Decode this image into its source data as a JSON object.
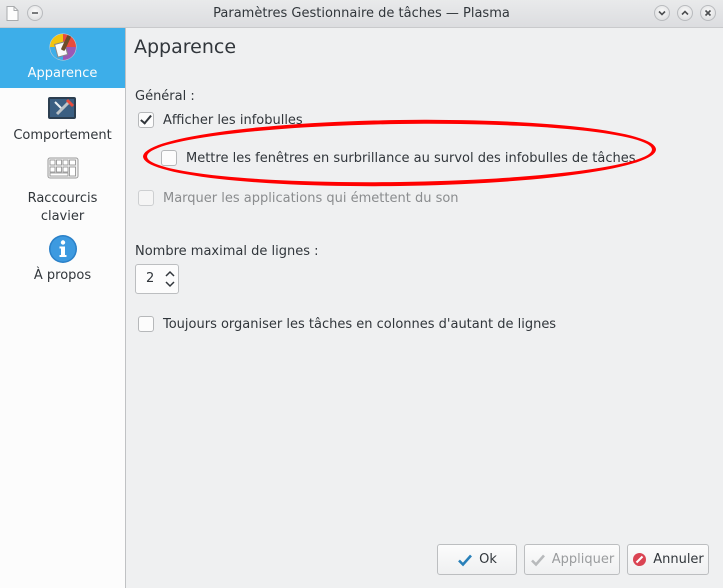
{
  "window": {
    "title": "Paramètres Gestionnaire de tâches — Plasma"
  },
  "sidebar": {
    "items": [
      {
        "label": "Apparence",
        "icon": "appearance-icon",
        "active": true
      },
      {
        "label": "Comportement",
        "icon": "behavior-icon",
        "active": false
      },
      {
        "label": "Raccourcis",
        "label2": "clavier",
        "icon": "keyboard-icon",
        "active": false
      },
      {
        "label": "À propos",
        "icon": "info-icon",
        "active": false
      }
    ]
  },
  "main": {
    "title": "Apparence",
    "general_label": "Général :",
    "options": [
      {
        "label": "Afficher les infobulles",
        "checked": true,
        "enabled": true
      },
      {
        "label": "Mettre les fenêtres en surbrillance au survol des infobulles de tâches",
        "checked": false,
        "enabled": true
      },
      {
        "label": "Marquer les applications qui émettent du son",
        "checked": false,
        "enabled": false
      }
    ],
    "max_rows_label": "Nombre maximal de lignes :",
    "max_rows_value": "2",
    "organize_label": "Toujours organiser les tâches en colonnes d'autant de lignes"
  },
  "buttons": {
    "ok": "Ok",
    "apply": "Appliquer",
    "cancel": "Annuler"
  },
  "colors": {
    "accent": "#3daee9",
    "annotation": "#ff0000"
  }
}
